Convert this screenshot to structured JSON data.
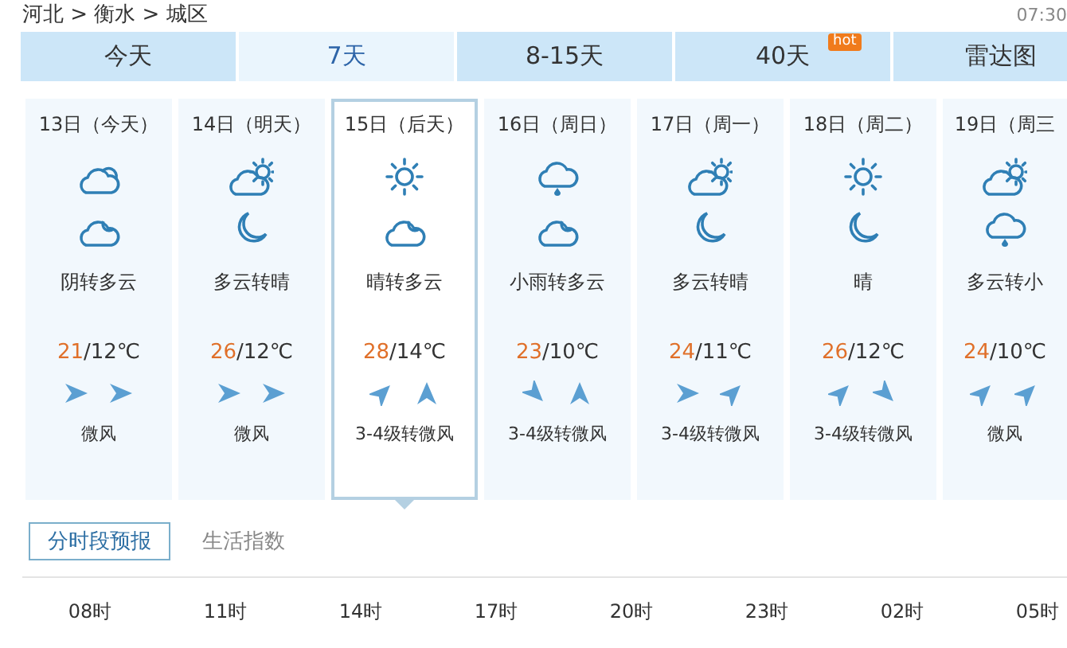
{
  "breadcrumb": "河北 > 衡水 > 城区",
  "update_time": "07:30",
  "tabs": [
    {
      "label": "今天",
      "selected": false
    },
    {
      "label": "7天",
      "selected": true
    },
    {
      "label": "8-15天",
      "selected": false
    },
    {
      "label": "40天",
      "selected": false,
      "badge": "hot"
    },
    {
      "label": "雷达图",
      "selected": false
    }
  ],
  "days": [
    {
      "date": "13日（今天）",
      "selected": false,
      "icons": [
        {
          "kind": "overcast"
        },
        {
          "kind": "cloud-night"
        }
      ],
      "weather": "阴转多云",
      "high": "21",
      "low": "/12℃",
      "winds": [
        {
          "kind": "e"
        },
        {
          "kind": "e"
        }
      ],
      "wind": "微风"
    },
    {
      "date": "14日（明天）",
      "selected": false,
      "icons": [
        {
          "kind": "cloud-sun"
        },
        {
          "kind": "moon"
        }
      ],
      "weather": "多云转晴",
      "high": "26",
      "low": "/12℃",
      "winds": [
        {
          "kind": "e"
        },
        {
          "kind": "e"
        }
      ],
      "wind": "微风"
    },
    {
      "date": "15日（后天）",
      "selected": true,
      "icons": [
        {
          "kind": "sun"
        },
        {
          "kind": "cloud-night"
        }
      ],
      "weather": "晴转多云",
      "high": "28",
      "low": "/14℃",
      "winds": [
        {
          "kind": "ne"
        },
        {
          "kind": "n"
        }
      ],
      "wind": "3-4级转微风"
    },
    {
      "date": "16日（周日）",
      "selected": false,
      "icons": [
        {
          "kind": "rain"
        },
        {
          "kind": "cloud-night"
        }
      ],
      "weather": "小雨转多云",
      "high": "23",
      "low": "/10℃",
      "winds": [
        {
          "kind": "se"
        },
        {
          "kind": "n"
        }
      ],
      "wind": "3-4级转微风"
    },
    {
      "date": "17日（周一）",
      "selected": false,
      "icons": [
        {
          "kind": "cloud-sun"
        },
        {
          "kind": "moon"
        }
      ],
      "weather": "多云转晴",
      "high": "24",
      "low": "/11℃",
      "winds": [
        {
          "kind": "e"
        },
        {
          "kind": "ne"
        }
      ],
      "wind": "3-4级转微风"
    },
    {
      "date": "18日（周二）",
      "selected": false,
      "icons": [
        {
          "kind": "sun"
        },
        {
          "kind": "moon"
        }
      ],
      "weather": "晴",
      "high": "26",
      "low": "/12℃",
      "winds": [
        {
          "kind": "ne"
        },
        {
          "kind": "se"
        }
      ],
      "wind": "3-4级转微风"
    },
    {
      "date": "19日（周三",
      "selected": false,
      "icons": [
        {
          "kind": "cloud-sun"
        },
        {
          "kind": "rain"
        }
      ],
      "weather": "多云转小",
      "high": "24",
      "low": "/10℃",
      "winds": [
        {
          "kind": "ne"
        },
        {
          "kind": "ne"
        }
      ],
      "wind": "微风"
    }
  ],
  "subtabs": [
    {
      "label": "分时段预报",
      "selected": true
    },
    {
      "label": "生活指数",
      "selected": false
    }
  ],
  "hours": [
    "08时",
    "11时",
    "14时",
    "17时",
    "20时",
    "23时",
    "02时",
    "05时"
  ]
}
